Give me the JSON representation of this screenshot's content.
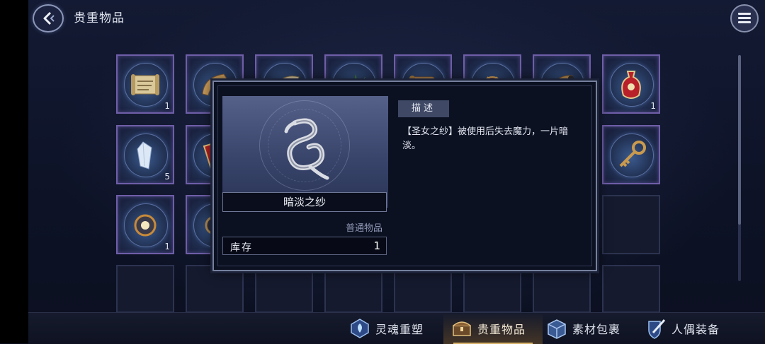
{
  "header": {
    "title": "贵重物品"
  },
  "grid": {
    "slots": [
      {
        "id": "r1c1",
        "icon": "scroll-icon",
        "count": "1"
      },
      {
        "id": "r1c2",
        "icon": "horn-icon",
        "count": ""
      },
      {
        "id": "r1c3",
        "icon": "horn-icon",
        "count": ""
      },
      {
        "id": "r1c4",
        "icon": "herb-icon",
        "count": ""
      },
      {
        "id": "r1c5",
        "icon": "scroll-icon",
        "count": ""
      },
      {
        "id": "r1c6",
        "icon": "bag-icon",
        "count": ""
      },
      {
        "id": "r1c7",
        "icon": "horn-icon",
        "count": ""
      },
      {
        "id": "r1c8",
        "icon": "vase-icon",
        "count": "1"
      },
      {
        "id": "r2c1",
        "icon": "crystal-icon",
        "count": "5"
      },
      {
        "id": "r2c2",
        "icon": "red-book-icon",
        "count": ""
      },
      {
        "id": "r2c8",
        "icon": "key-icon",
        "count": ""
      },
      {
        "id": "r3c1",
        "icon": "orb-icon",
        "count": "1"
      },
      {
        "id": "r3c2",
        "icon": "compass-icon",
        "count": ""
      }
    ]
  },
  "popup": {
    "item_name": "暗淡之纱",
    "category": "普通物品",
    "stock_label": "库存",
    "stock_value": "1",
    "desc_tab": "描述",
    "description": "【圣女之纱】被使用后失去魔力，一片暗淡。",
    "item_icon": "ribbon-icon"
  },
  "bottom_tabs": [
    {
      "label": "灵魂重塑",
      "icon": "soul-icon",
      "active": false
    },
    {
      "label": "贵重物品",
      "icon": "treasure-chest-icon",
      "active": true
    },
    {
      "label": "素材包裹",
      "icon": "package-icon",
      "active": false
    },
    {
      "label": "人偶装备",
      "icon": "shield-sword-icon",
      "active": false
    }
  ],
  "colors": {
    "accent_gold": "#d9b26a",
    "slot_border": "#6f5ea8",
    "panel_bg": "#0c1122"
  }
}
